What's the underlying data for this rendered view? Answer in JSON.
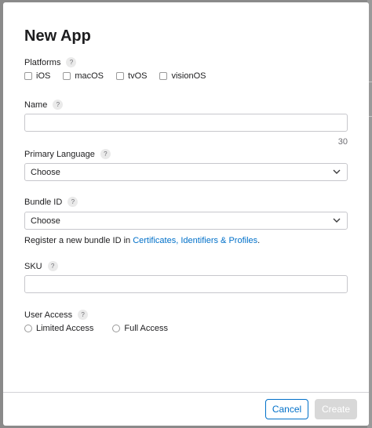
{
  "dialog": {
    "title": "New App",
    "platforms": {
      "label": "Platforms",
      "help": "?",
      "options": [
        {
          "label": "iOS",
          "checked": false
        },
        {
          "label": "macOS",
          "checked": false
        },
        {
          "label": "tvOS",
          "checked": false
        },
        {
          "label": "visionOS",
          "checked": false
        }
      ]
    },
    "name": {
      "label": "Name",
      "help": "?",
      "value": "",
      "max_chars": "30"
    },
    "primary_language": {
      "label": "Primary Language",
      "help": "?",
      "selected": "Choose"
    },
    "bundle_id": {
      "label": "Bundle ID",
      "help": "?",
      "selected": "Choose",
      "hint_prefix": "Register a new bundle ID in ",
      "hint_link": "Certificates, Identifiers & Profiles",
      "hint_suffix": "."
    },
    "sku": {
      "label": "SKU",
      "help": "?",
      "value": ""
    },
    "user_access": {
      "label": "User Access",
      "help": "?",
      "options": [
        {
          "label": "Limited Access",
          "selected": false
        },
        {
          "label": "Full Access",
          "selected": false
        }
      ]
    },
    "buttons": {
      "cancel": "Cancel",
      "create": "Create"
    }
  },
  "colors": {
    "accent": "#0070c9",
    "disabled_button": "#d8d8d8"
  }
}
